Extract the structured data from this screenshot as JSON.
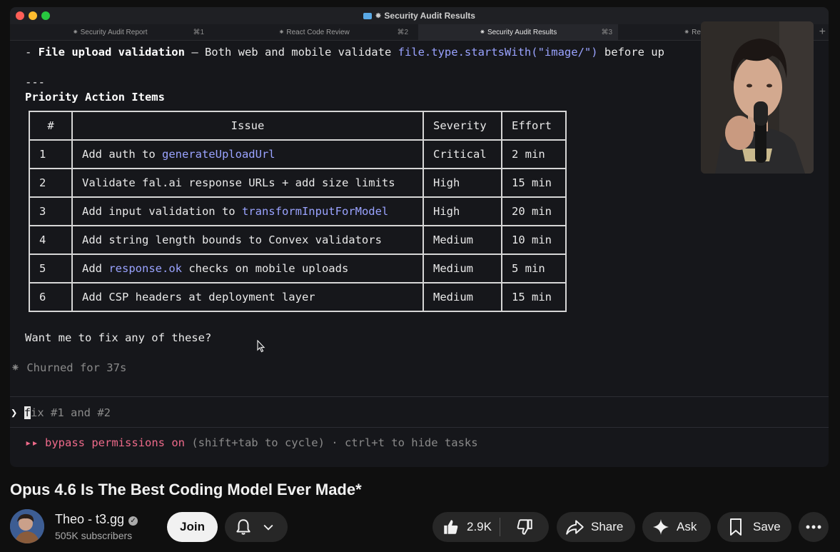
{
  "window": {
    "title": "⁕ Security Audit Results",
    "tabs": [
      {
        "label": "⁕ Security Audit Report",
        "shortcut": "⌘1"
      },
      {
        "label": "⁕ React Code Review",
        "shortcut": "⌘2"
      },
      {
        "label": "⁕ Security Audit Results",
        "shortcut": "⌘3"
      },
      {
        "label": "⁕ Reac",
        "shortcut": ""
      }
    ],
    "new_tab": "+"
  },
  "terminal": {
    "line1_prefix": "- ",
    "line1_bold": "File upload validation",
    "line1_mid": " — Both web and mobile validate ",
    "line1_code": "file.type.startsWith(\"image/\")",
    "line1_tail": " before up",
    "divider": "---",
    "heading": "Priority Action Items",
    "table": {
      "headers": [
        "#",
        "Issue",
        "Severity",
        "Effort"
      ],
      "rows": [
        {
          "num": "1",
          "pre": "Add auth to ",
          "code": "generateUploadUrl",
          "post": "",
          "severity": "Critical",
          "effort": "2 min"
        },
        {
          "num": "2",
          "pre": "Validate fal.ai response URLs + add size limits",
          "code": "",
          "post": "",
          "severity": "High",
          "effort": "15 min"
        },
        {
          "num": "3",
          "pre": "Add input validation to ",
          "code": "transformInputForModel",
          "post": "",
          "severity": "High",
          "effort": "20 min"
        },
        {
          "num": "4",
          "pre": "Add string length bounds to Convex validators",
          "code": "",
          "post": "",
          "severity": "Medium",
          "effort": "10 min"
        },
        {
          "num": "5",
          "pre": "Add ",
          "code": "response.ok",
          "post": " checks on mobile uploads",
          "severity": "Medium",
          "effort": "5 min"
        },
        {
          "num": "6",
          "pre": "Add CSP headers at deployment layer",
          "code": "",
          "post": "",
          "severity": "Medium",
          "effort": "15 min"
        }
      ]
    },
    "question": "Want me to fix any of these?",
    "status": "⁕ Churned for 37s",
    "prompt_symbol": "❯",
    "input_cursor_char": "f",
    "input_rest": "ix #1 and #2",
    "mode_arrows": "▸▸",
    "mode_text": "bypass permissions on",
    "mode_hint": " (shift+tab to cycle) · ctrl+t to hide tasks"
  },
  "video": {
    "title": "Opus 4.6 Is The Best Coding Model Ever Made*",
    "channel": "Theo - t3.gg",
    "subscribers": "505K subscribers",
    "join_label": "Join",
    "likes": "2.9K",
    "share_label": "Share",
    "ask_label": "Ask",
    "save_label": "Save"
  },
  "colors": {
    "terminal_bg": "#16171b",
    "code_accent": "#9aa3ff",
    "permission_accent": "#ee6a8a",
    "page_bg": "#0f0f0f"
  }
}
